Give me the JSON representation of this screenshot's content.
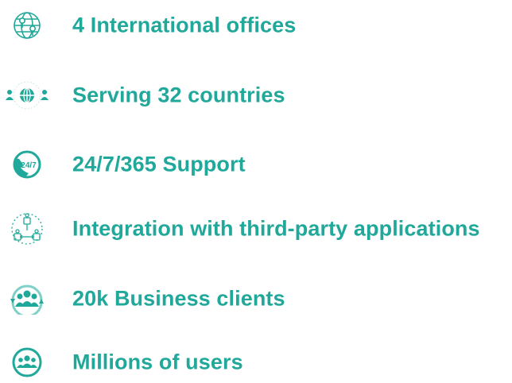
{
  "features": [
    {
      "icon": "globe-network-icon",
      "label": "4 International offices"
    },
    {
      "icon": "globe-people-icon",
      "label": "Serving 32 countries"
    },
    {
      "icon": "support-phone-24-7-icon",
      "label": "24/7/365 Support",
      "badge": "24/7"
    },
    {
      "icon": "integration-network-icon",
      "label": "Integration with third-party applications"
    },
    {
      "icon": "business-clients-icon",
      "label": "20k Business clients"
    },
    {
      "icon": "users-group-icon",
      "label": "Millions of users"
    }
  ],
  "colors": {
    "accent": "#20a89a",
    "accent_light": "#7fd0c8"
  }
}
